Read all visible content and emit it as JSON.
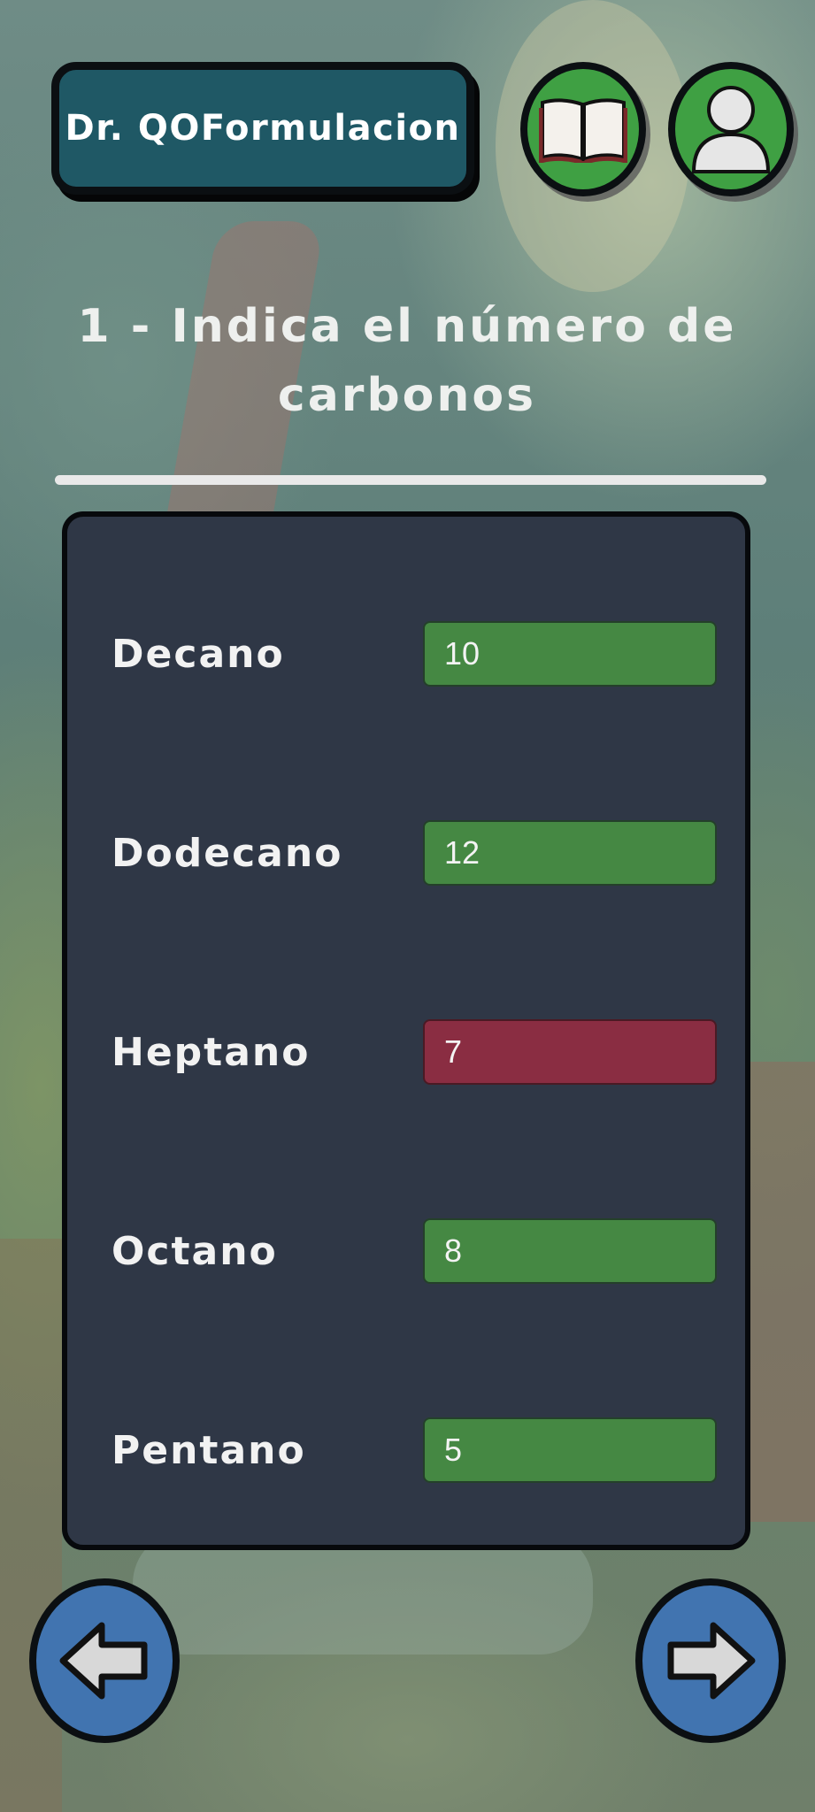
{
  "header": {
    "app_title": "Dr. QOFormulacion",
    "book_icon": "book-icon",
    "profile_icon": "user-profile-icon"
  },
  "question": {
    "text": "1 - Indica el número de carbonos"
  },
  "rows": [
    {
      "name": "Decano",
      "value": "10",
      "status": "correct"
    },
    {
      "name": "Dodecano",
      "value": "12",
      "status": "correct"
    },
    {
      "name": "Heptano",
      "value": "7",
      "status": "incorrect"
    },
    {
      "name": "Octano",
      "value": "8",
      "status": "correct"
    },
    {
      "name": "Pentano",
      "value": "5",
      "status": "correct"
    }
  ],
  "navigation": {
    "prev_icon": "arrow-left-icon",
    "next_icon": "arrow-right-icon"
  },
  "colors": {
    "correct": "#458843",
    "incorrect": "#8a2d42",
    "title_button": "#1f5865",
    "round_button": "#3fa043",
    "nav_button": "#4174b0",
    "panel": "#2f3746"
  }
}
